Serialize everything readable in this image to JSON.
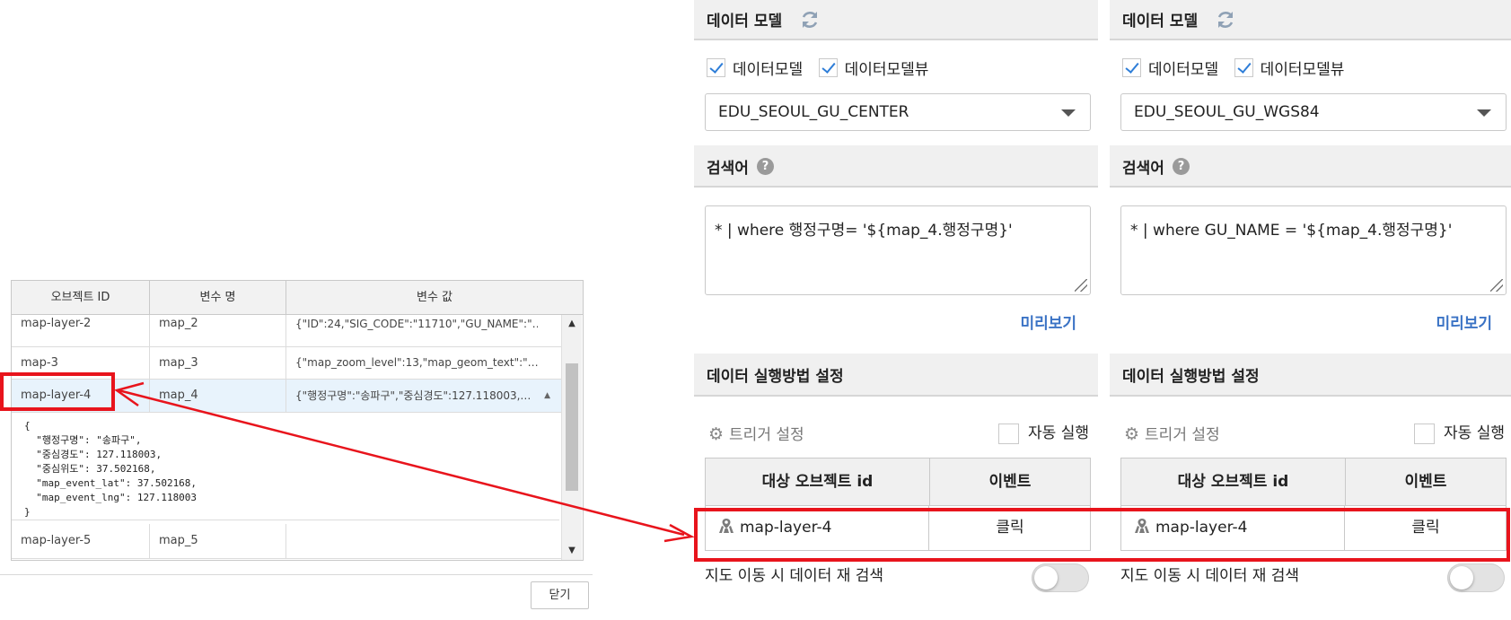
{
  "variable_table": {
    "headers": [
      "오브젝트 ID",
      "변수 명",
      "변수 값"
    ],
    "rows": [
      {
        "object_id": "map-layer-2",
        "var_name": "map_2",
        "value": "{\"ID\":24,\"SIG_CODE\":\"11710\",\"GU_NAME\":\"…"
      },
      {
        "object_id": "map-3",
        "var_name": "map_3",
        "value": "{\"map_zoom_level\":13,\"map_geom_text\":\"…"
      },
      {
        "object_id": "map-layer-4",
        "var_name": "map_4",
        "value": "{\"행정구명\":\"송파구\",\"중심경도\":127.118003,…"
      },
      {
        "object_id": "map-layer-5",
        "var_name": "map_5",
        "value": ""
      }
    ],
    "expanded_json": "{\n  \"행정구명\": \"송파구\",\n  \"중심경도\": 127.118003,\n  \"중심위도\": 37.502168,\n  \"map_event_lat\": 37.502168,\n  \"map_event_lng\": 127.118003\n}",
    "close_label": "닫기"
  },
  "panels": [
    {
      "data_model_title": "데이터 모델",
      "check_datamodel": "데이터모델",
      "check_datamodelview": "데이터모델뷰",
      "selected_model": "EDU_SEOUL_GU_CENTER",
      "search_title": "검색어",
      "query": "* | where 행정구명=  '${map_4.행정구명}'",
      "preview": "미리보기",
      "exec_title": "데이터 실행방법 설정",
      "trigger_label": "트리거 설정",
      "auto_run_label": "자동 실행",
      "target_header": "대상 오브젝트 id",
      "event_header": "이벤트",
      "target_value": "map-layer-4",
      "event_value": "클릭",
      "research_label": "지도 이동 시 데이터 재 검색"
    },
    {
      "data_model_title": "데이터 모델",
      "check_datamodel": "데이터모델",
      "check_datamodelview": "데이터모델뷰",
      "selected_model": "EDU_SEOUL_GU_WGS84",
      "search_title": "검색어",
      "query": "* | where GU_NAME =  '${map_4.행정구명}'",
      "preview": "미리보기",
      "exec_title": "데이터 실행방법 설정",
      "trigger_label": "트리거 설정",
      "auto_run_label": "자동 실행",
      "target_header": "대상 오브젝트 id",
      "event_header": "이벤트",
      "target_value": "map-layer-4",
      "event_value": "클릭",
      "research_label": "지도 이동 시 데이터 재 검색"
    }
  ],
  "colors": {
    "highlight": "#e8141c",
    "accent": "#2f7ed8",
    "link": "#3b73c5"
  }
}
